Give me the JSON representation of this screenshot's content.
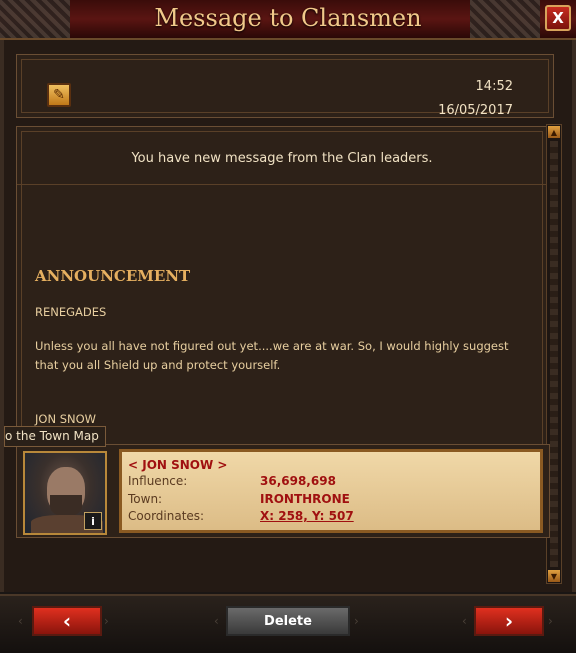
{
  "window": {
    "title": "Message to Clansmen",
    "close_label": "X"
  },
  "header": {
    "icon": "scroll-icon",
    "time": "14:52",
    "date": "16/05/2017"
  },
  "message": {
    "notice": "You have new message from the Clan leaders.",
    "heading": "ANNOUNCEMENT",
    "line1": "RENEGADES",
    "paragraph": "Unless you all have not figured out yet....we are at war. So, I would highly suggest that you all Shield up and protect yourself.",
    "signature": "JON SNOW"
  },
  "tooltip": "o the Town Map",
  "sender": {
    "name": "< JON SNOW >",
    "influence_label": "Influence:",
    "influence_value": "36,698,698",
    "town_label": "Town:",
    "town_value": "IRONTHRONE",
    "coords_label": "Coordinates:",
    "coords_value": "X: 258, Y: 507",
    "info_label": "i"
  },
  "footer": {
    "prev_label": "‹",
    "delete_label": "Delete",
    "next_label": "›"
  },
  "colors": {
    "accent_red": "#a01010",
    "title_gold": "#f1c98a"
  }
}
